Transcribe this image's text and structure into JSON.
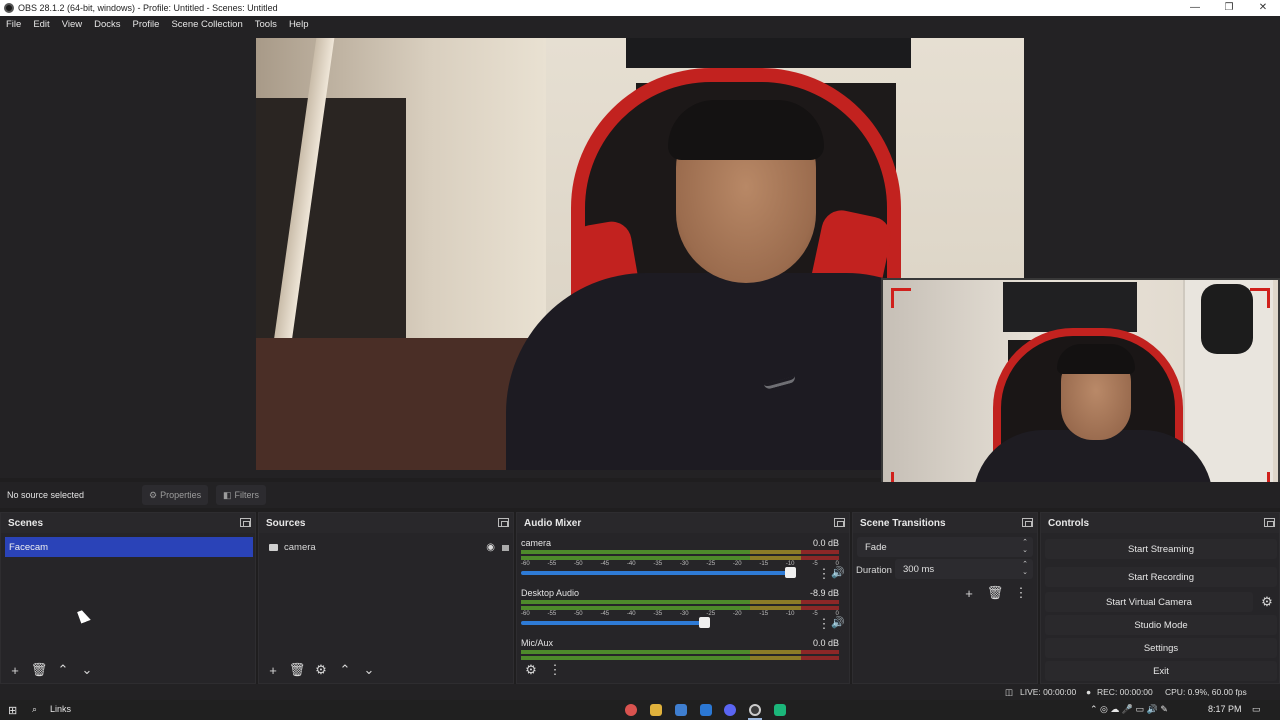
{
  "window": {
    "title": "OBS 28.1.2 (64-bit, windows) - Profile: Untitled - Scenes: Untitled",
    "controls": [
      "—",
      "❐",
      "✕"
    ]
  },
  "menu": [
    "File",
    "Edit",
    "View",
    "Docks",
    "Profile",
    "Scene Collection",
    "Tools",
    "Help"
  ],
  "source_bar": {
    "status": "No source selected",
    "properties_label": "Properties",
    "filters_label": "Filters"
  },
  "scenes": {
    "title": "Scenes",
    "items": [
      "Facecam"
    ]
  },
  "sources": {
    "title": "Sources",
    "items": [
      {
        "name": "camera",
        "icon": "camera-icon"
      }
    ]
  },
  "mixer": {
    "title": "Audio Mixer",
    "channels": [
      {
        "name": "camera",
        "db": "0.0 dB",
        "volume": 1.0
      },
      {
        "name": "Desktop Audio",
        "db": "-8.9 dB",
        "volume": 0.68
      },
      {
        "name": "Mic/Aux",
        "db": "0.0 dB",
        "volume": 1.0
      }
    ],
    "ticks": [
      "-60",
      "-55",
      "-50",
      "-45",
      "-40",
      "-35",
      "-30",
      "-25",
      "-20",
      "-15",
      "-10",
      "-5",
      "0"
    ]
  },
  "transitions": {
    "title": "Scene Transitions",
    "selected": "Fade",
    "duration_label": "Duration",
    "duration_value": "300 ms"
  },
  "controls": {
    "title": "Controls",
    "start_streaming": "Start Streaming",
    "start_recording": "Start Recording",
    "start_virtual_camera": "Start Virtual Camera",
    "studio_mode": "Studio Mode",
    "settings": "Settings",
    "exit": "Exit"
  },
  "status": {
    "live": "LIVE: 00:00:00",
    "rec": "REC: 00:00:00",
    "cpu": "CPU: 0.9%, 60.00 fps"
  },
  "taskbar": {
    "search": "Links",
    "time": "8:17 PM"
  },
  "colors": {
    "selected_scene": "#2a43b8",
    "volume_slider": "#2e7bd6",
    "chair_red": "#c2221f"
  }
}
